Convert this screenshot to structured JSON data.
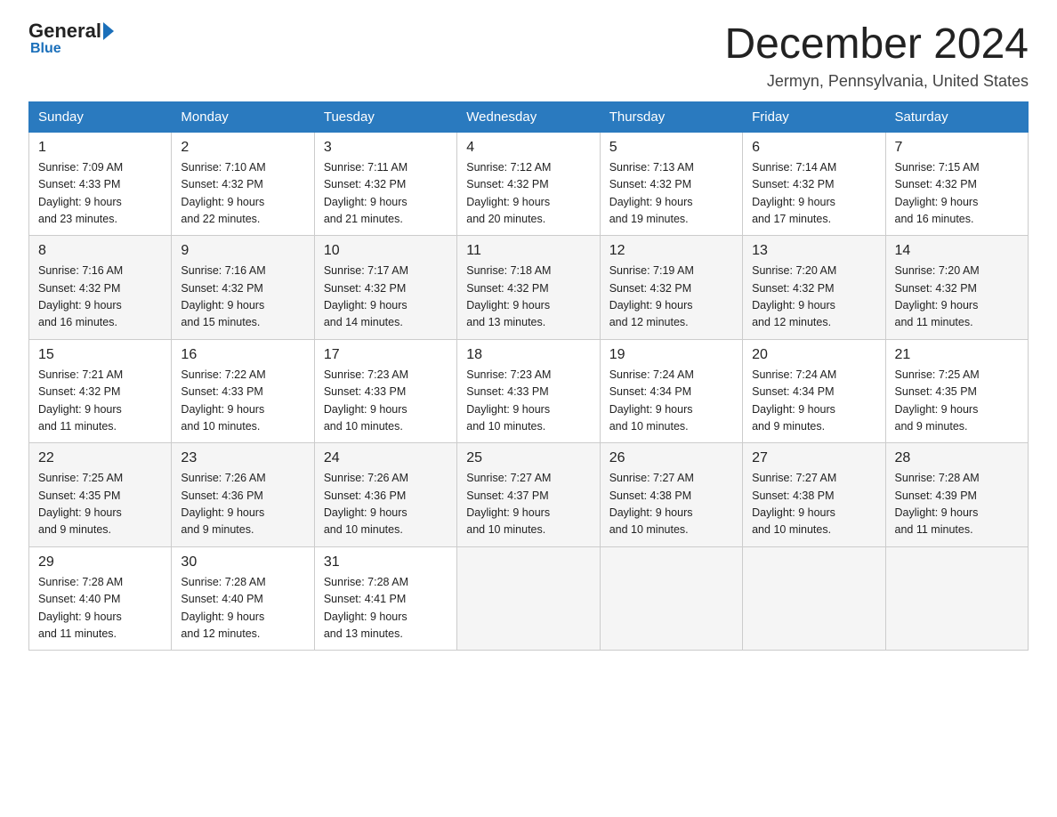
{
  "logo": {
    "general": "General",
    "blue": "Blue"
  },
  "title": "December 2024",
  "location": "Jermyn, Pennsylvania, United States",
  "days_of_week": [
    "Sunday",
    "Monday",
    "Tuesday",
    "Wednesday",
    "Thursday",
    "Friday",
    "Saturday"
  ],
  "weeks": [
    [
      {
        "day": "1",
        "sunrise": "7:09 AM",
        "sunset": "4:33 PM",
        "daylight": "9 hours and 23 minutes."
      },
      {
        "day": "2",
        "sunrise": "7:10 AM",
        "sunset": "4:32 PM",
        "daylight": "9 hours and 22 minutes."
      },
      {
        "day": "3",
        "sunrise": "7:11 AM",
        "sunset": "4:32 PM",
        "daylight": "9 hours and 21 minutes."
      },
      {
        "day": "4",
        "sunrise": "7:12 AM",
        "sunset": "4:32 PM",
        "daylight": "9 hours and 20 minutes."
      },
      {
        "day": "5",
        "sunrise": "7:13 AM",
        "sunset": "4:32 PM",
        "daylight": "9 hours and 19 minutes."
      },
      {
        "day": "6",
        "sunrise": "7:14 AM",
        "sunset": "4:32 PM",
        "daylight": "9 hours and 17 minutes."
      },
      {
        "day": "7",
        "sunrise": "7:15 AM",
        "sunset": "4:32 PM",
        "daylight": "9 hours and 16 minutes."
      }
    ],
    [
      {
        "day": "8",
        "sunrise": "7:16 AM",
        "sunset": "4:32 PM",
        "daylight": "9 hours and 16 minutes."
      },
      {
        "day": "9",
        "sunrise": "7:16 AM",
        "sunset": "4:32 PM",
        "daylight": "9 hours and 15 minutes."
      },
      {
        "day": "10",
        "sunrise": "7:17 AM",
        "sunset": "4:32 PM",
        "daylight": "9 hours and 14 minutes."
      },
      {
        "day": "11",
        "sunrise": "7:18 AM",
        "sunset": "4:32 PM",
        "daylight": "9 hours and 13 minutes."
      },
      {
        "day": "12",
        "sunrise": "7:19 AM",
        "sunset": "4:32 PM",
        "daylight": "9 hours and 12 minutes."
      },
      {
        "day": "13",
        "sunrise": "7:20 AM",
        "sunset": "4:32 PM",
        "daylight": "9 hours and 12 minutes."
      },
      {
        "day": "14",
        "sunrise": "7:20 AM",
        "sunset": "4:32 PM",
        "daylight": "9 hours and 11 minutes."
      }
    ],
    [
      {
        "day": "15",
        "sunrise": "7:21 AM",
        "sunset": "4:32 PM",
        "daylight": "9 hours and 11 minutes."
      },
      {
        "day": "16",
        "sunrise": "7:22 AM",
        "sunset": "4:33 PM",
        "daylight": "9 hours and 10 minutes."
      },
      {
        "day": "17",
        "sunrise": "7:23 AM",
        "sunset": "4:33 PM",
        "daylight": "9 hours and 10 minutes."
      },
      {
        "day": "18",
        "sunrise": "7:23 AM",
        "sunset": "4:33 PM",
        "daylight": "9 hours and 10 minutes."
      },
      {
        "day": "19",
        "sunrise": "7:24 AM",
        "sunset": "4:34 PM",
        "daylight": "9 hours and 10 minutes."
      },
      {
        "day": "20",
        "sunrise": "7:24 AM",
        "sunset": "4:34 PM",
        "daylight": "9 hours and 9 minutes."
      },
      {
        "day": "21",
        "sunrise": "7:25 AM",
        "sunset": "4:35 PM",
        "daylight": "9 hours and 9 minutes."
      }
    ],
    [
      {
        "day": "22",
        "sunrise": "7:25 AM",
        "sunset": "4:35 PM",
        "daylight": "9 hours and 9 minutes."
      },
      {
        "day": "23",
        "sunrise": "7:26 AM",
        "sunset": "4:36 PM",
        "daylight": "9 hours and 9 minutes."
      },
      {
        "day": "24",
        "sunrise": "7:26 AM",
        "sunset": "4:36 PM",
        "daylight": "9 hours and 10 minutes."
      },
      {
        "day": "25",
        "sunrise": "7:27 AM",
        "sunset": "4:37 PM",
        "daylight": "9 hours and 10 minutes."
      },
      {
        "day": "26",
        "sunrise": "7:27 AM",
        "sunset": "4:38 PM",
        "daylight": "9 hours and 10 minutes."
      },
      {
        "day": "27",
        "sunrise": "7:27 AM",
        "sunset": "4:38 PM",
        "daylight": "9 hours and 10 minutes."
      },
      {
        "day": "28",
        "sunrise": "7:28 AM",
        "sunset": "4:39 PM",
        "daylight": "9 hours and 11 minutes."
      }
    ],
    [
      {
        "day": "29",
        "sunrise": "7:28 AM",
        "sunset": "4:40 PM",
        "daylight": "9 hours and 11 minutes."
      },
      {
        "day": "30",
        "sunrise": "7:28 AM",
        "sunset": "4:40 PM",
        "daylight": "9 hours and 12 minutes."
      },
      {
        "day": "31",
        "sunrise": "7:28 AM",
        "sunset": "4:41 PM",
        "daylight": "9 hours and 13 minutes."
      },
      null,
      null,
      null,
      null
    ]
  ],
  "labels": {
    "sunrise": "Sunrise:",
    "sunset": "Sunset:",
    "daylight": "Daylight:"
  }
}
